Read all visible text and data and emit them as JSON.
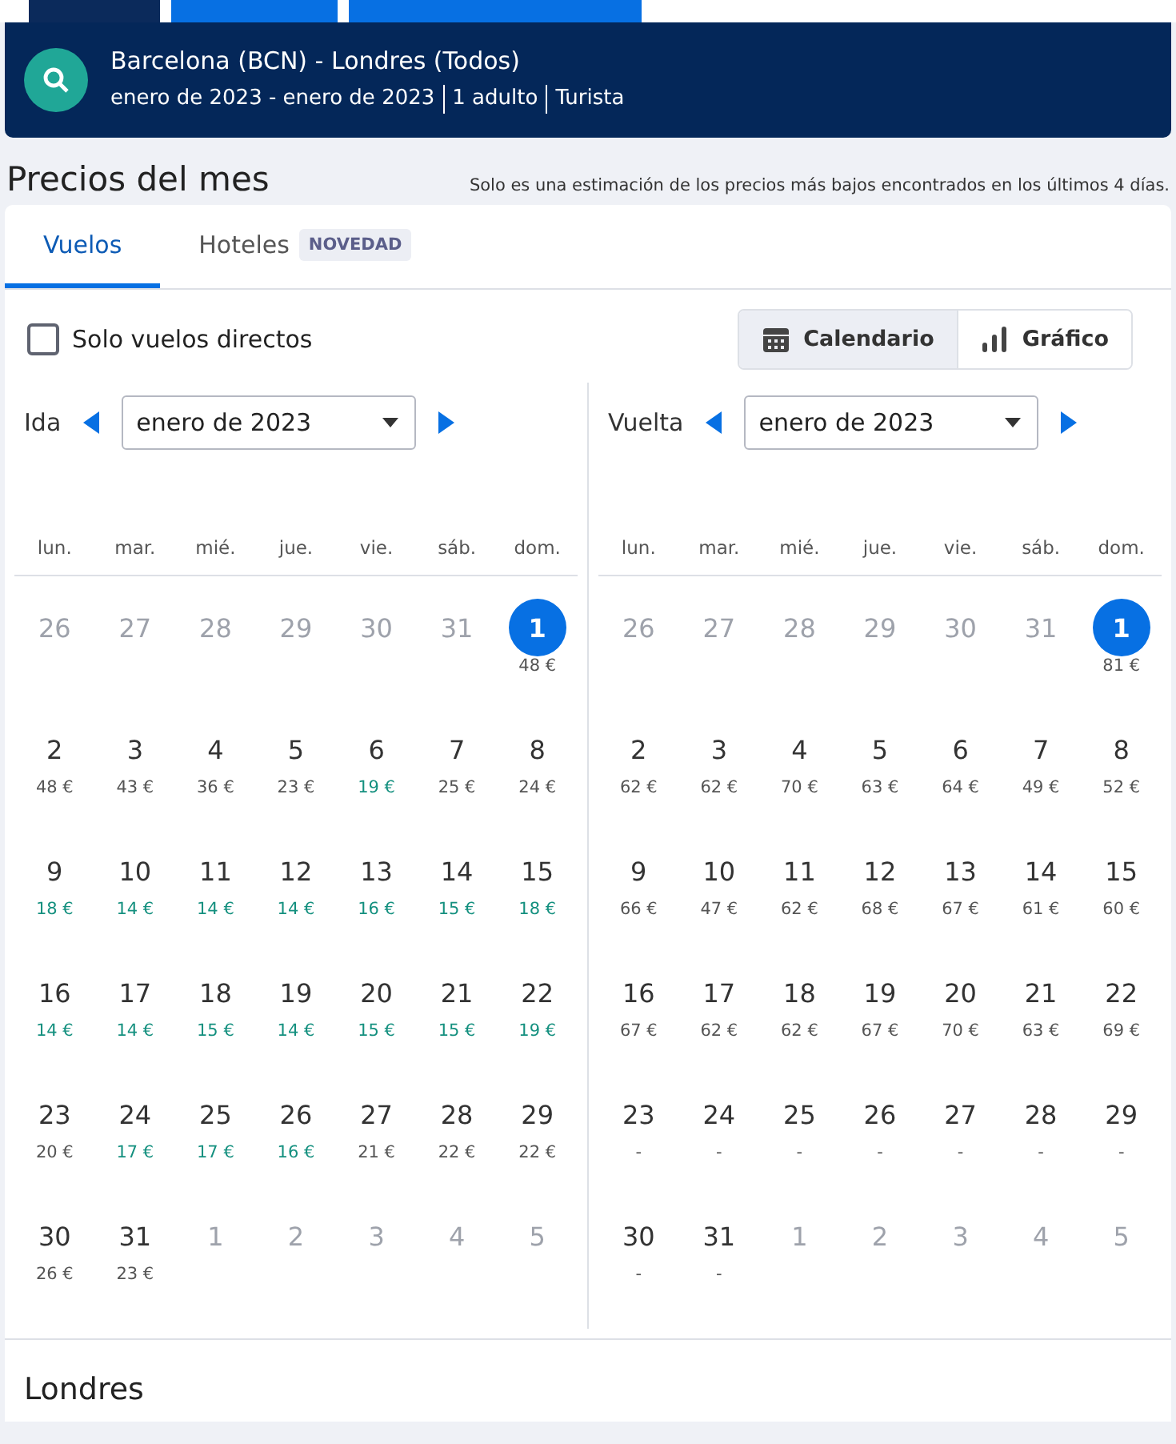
{
  "top_tabs": [
    {
      "selected": true
    },
    {
      "selected": false
    },
    {
      "selected": false
    }
  ],
  "search_summary": {
    "route": "Barcelona (BCN) - Londres (Todos)",
    "details": [
      "enero de 2023 - enero de 2023",
      "1 adulto",
      "Turista"
    ]
  },
  "heading": "Precios del mes",
  "note": "Solo es una estimación de los precios más bajos encontrados en los últimos 4 días.",
  "tabs": [
    {
      "label": "Vuelos",
      "selected": true
    },
    {
      "label": "Hoteles",
      "badge": "NOVEDAD",
      "selected": false
    }
  ],
  "direct_only": {
    "label": "Solo vuelos directos",
    "checked": false
  },
  "view_toggle": [
    {
      "label": "Calendario",
      "kind": "calendar",
      "selected": true
    },
    {
      "label": "Gráfico",
      "kind": "chart",
      "selected": false
    }
  ],
  "calendars": [
    {
      "label": "Ida",
      "month": "enero de 2023",
      "weekdays": [
        "lun.",
        "mar.",
        "mié.",
        "jue.",
        "vie.",
        "sáb.",
        "dom."
      ],
      "days": [
        {
          "day": "26",
          "outside": true,
          "selected": false
        },
        {
          "day": "27",
          "outside": true,
          "selected": false
        },
        {
          "day": "28",
          "outside": true,
          "selected": false
        },
        {
          "day": "29",
          "outside": true,
          "selected": false
        },
        {
          "day": "30",
          "outside": true,
          "selected": false
        },
        {
          "day": "31",
          "outside": true,
          "selected": false
        },
        {
          "day": "1",
          "price": "48 €",
          "cheap": false,
          "outside": false,
          "selected": true
        },
        {
          "day": "2",
          "price": "48 €",
          "cheap": false,
          "outside": false,
          "selected": false
        },
        {
          "day": "3",
          "price": "43 €",
          "cheap": false,
          "outside": false,
          "selected": false
        },
        {
          "day": "4",
          "price": "36 €",
          "cheap": false,
          "outside": false,
          "selected": false
        },
        {
          "day": "5",
          "price": "23 €",
          "cheap": false,
          "outside": false,
          "selected": false
        },
        {
          "day": "6",
          "price": "19 €",
          "cheap": true,
          "outside": false,
          "selected": false
        },
        {
          "day": "7",
          "price": "25 €",
          "cheap": false,
          "outside": false,
          "selected": false
        },
        {
          "day": "8",
          "price": "24 €",
          "cheap": false,
          "outside": false,
          "selected": false
        },
        {
          "day": "9",
          "price": "18 €",
          "cheap": true,
          "outside": false,
          "selected": false
        },
        {
          "day": "10",
          "price": "14 €",
          "cheap": true,
          "outside": false,
          "selected": false
        },
        {
          "day": "11",
          "price": "14 €",
          "cheap": true,
          "outside": false,
          "selected": false
        },
        {
          "day": "12",
          "price": "14 €",
          "cheap": true,
          "outside": false,
          "selected": false
        },
        {
          "day": "13",
          "price": "16 €",
          "cheap": true,
          "outside": false,
          "selected": false
        },
        {
          "day": "14",
          "price": "15 €",
          "cheap": true,
          "outside": false,
          "selected": false
        },
        {
          "day": "15",
          "price": "18 €",
          "cheap": true,
          "outside": false,
          "selected": false
        },
        {
          "day": "16",
          "price": "14 €",
          "cheap": true,
          "outside": false,
          "selected": false
        },
        {
          "day": "17",
          "price": "14 €",
          "cheap": true,
          "outside": false,
          "selected": false
        },
        {
          "day": "18",
          "price": "15 €",
          "cheap": true,
          "outside": false,
          "selected": false
        },
        {
          "day": "19",
          "price": "14 €",
          "cheap": true,
          "outside": false,
          "selected": false
        },
        {
          "day": "20",
          "price": "15 €",
          "cheap": true,
          "outside": false,
          "selected": false
        },
        {
          "day": "21",
          "price": "15 €",
          "cheap": true,
          "outside": false,
          "selected": false
        },
        {
          "day": "22",
          "price": "19 €",
          "cheap": true,
          "outside": false,
          "selected": false
        },
        {
          "day": "23",
          "price": "20 €",
          "cheap": false,
          "outside": false,
          "selected": false
        },
        {
          "day": "24",
          "price": "17 €",
          "cheap": true,
          "outside": false,
          "selected": false
        },
        {
          "day": "25",
          "price": "17 €",
          "cheap": true,
          "outside": false,
          "selected": false
        },
        {
          "day": "26",
          "price": "16 €",
          "cheap": true,
          "outside": false,
          "selected": false
        },
        {
          "day": "27",
          "price": "21 €",
          "cheap": false,
          "outside": false,
          "selected": false
        },
        {
          "day": "28",
          "price": "22 €",
          "cheap": false,
          "outside": false,
          "selected": false
        },
        {
          "day": "29",
          "price": "22 €",
          "cheap": false,
          "outside": false,
          "selected": false
        },
        {
          "day": "30",
          "price": "26 €",
          "cheap": false,
          "outside": false,
          "selected": false
        },
        {
          "day": "31",
          "price": "23 €",
          "cheap": false,
          "outside": false,
          "selected": false
        },
        {
          "day": "1",
          "outside": true,
          "selected": false
        },
        {
          "day": "2",
          "outside": true,
          "selected": false
        },
        {
          "day": "3",
          "outside": true,
          "selected": false
        },
        {
          "day": "4",
          "outside": true,
          "selected": false
        },
        {
          "day": "5",
          "outside": true,
          "selected": false
        }
      ]
    },
    {
      "label": "Vuelta",
      "month": "enero de 2023",
      "weekdays": [
        "lun.",
        "mar.",
        "mié.",
        "jue.",
        "vie.",
        "sáb.",
        "dom."
      ],
      "days": [
        {
          "day": "26",
          "outside": true,
          "selected": false
        },
        {
          "day": "27",
          "outside": true,
          "selected": false
        },
        {
          "day": "28",
          "outside": true,
          "selected": false
        },
        {
          "day": "29",
          "outside": true,
          "selected": false
        },
        {
          "day": "30",
          "outside": true,
          "selected": false
        },
        {
          "day": "31",
          "outside": true,
          "selected": false
        },
        {
          "day": "1",
          "price": "81 €",
          "cheap": false,
          "outside": false,
          "selected": true
        },
        {
          "day": "2",
          "price": "62 €",
          "cheap": false,
          "outside": false,
          "selected": false
        },
        {
          "day": "3",
          "price": "62 €",
          "cheap": false,
          "outside": false,
          "selected": false
        },
        {
          "day": "4",
          "price": "70 €",
          "cheap": false,
          "outside": false,
          "selected": false
        },
        {
          "day": "5",
          "price": "63 €",
          "cheap": false,
          "outside": false,
          "selected": false
        },
        {
          "day": "6",
          "price": "64 €",
          "cheap": false,
          "outside": false,
          "selected": false
        },
        {
          "day": "7",
          "price": "49 €",
          "cheap": false,
          "outside": false,
          "selected": false
        },
        {
          "day": "8",
          "price": "52 €",
          "cheap": false,
          "outside": false,
          "selected": false
        },
        {
          "day": "9",
          "price": "66 €",
          "cheap": false,
          "outside": false,
          "selected": false
        },
        {
          "day": "10",
          "price": "47 €",
          "cheap": false,
          "outside": false,
          "selected": false
        },
        {
          "day": "11",
          "price": "62 €",
          "cheap": false,
          "outside": false,
          "selected": false
        },
        {
          "day": "12",
          "price": "68 €",
          "cheap": false,
          "outside": false,
          "selected": false
        },
        {
          "day": "13",
          "price": "67 €",
          "cheap": false,
          "outside": false,
          "selected": false
        },
        {
          "day": "14",
          "price": "61 €",
          "cheap": false,
          "outside": false,
          "selected": false
        },
        {
          "day": "15",
          "price": "60 €",
          "cheap": false,
          "outside": false,
          "selected": false
        },
        {
          "day": "16",
          "price": "67 €",
          "cheap": false,
          "outside": false,
          "selected": false
        },
        {
          "day": "17",
          "price": "62 €",
          "cheap": false,
          "outside": false,
          "selected": false
        },
        {
          "day": "18",
          "price": "62 €",
          "cheap": false,
          "outside": false,
          "selected": false
        },
        {
          "day": "19",
          "price": "67 €",
          "cheap": false,
          "outside": false,
          "selected": false
        },
        {
          "day": "20",
          "price": "70 €",
          "cheap": false,
          "outside": false,
          "selected": false
        },
        {
          "day": "21",
          "price": "63 €",
          "cheap": false,
          "outside": false,
          "selected": false
        },
        {
          "day": "22",
          "price": "69 €",
          "cheap": false,
          "outside": false,
          "selected": false
        },
        {
          "day": "23",
          "price": "-",
          "cheap": false,
          "outside": false,
          "selected": false
        },
        {
          "day": "24",
          "price": "-",
          "cheap": false,
          "outside": false,
          "selected": false
        },
        {
          "day": "25",
          "price": "-",
          "cheap": false,
          "outside": false,
          "selected": false
        },
        {
          "day": "26",
          "price": "-",
          "cheap": false,
          "outside": false,
          "selected": false
        },
        {
          "day": "27",
          "price": "-",
          "cheap": false,
          "outside": false,
          "selected": false
        },
        {
          "day": "28",
          "price": "-",
          "cheap": false,
          "outside": false,
          "selected": false
        },
        {
          "day": "29",
          "price": "-",
          "cheap": false,
          "outside": false,
          "selected": false
        },
        {
          "day": "30",
          "price": "-",
          "cheap": false,
          "outside": false,
          "selected": false
        },
        {
          "day": "31",
          "price": "-",
          "cheap": false,
          "outside": false,
          "selected": false
        },
        {
          "day": "1",
          "outside": true,
          "selected": false
        },
        {
          "day": "2",
          "outside": true,
          "selected": false
        },
        {
          "day": "3",
          "outside": true,
          "selected": false
        },
        {
          "day": "4",
          "outside": true,
          "selected": false
        },
        {
          "day": "5",
          "outside": true,
          "selected": false
        }
      ]
    }
  ],
  "destination": {
    "title": "Londres"
  }
}
